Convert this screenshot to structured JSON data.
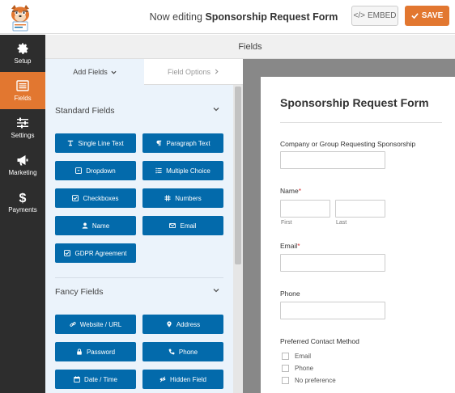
{
  "header": {
    "title_prefix": "Now editing",
    "form_name": "Sponsorship Request Form",
    "embed_label": "EMBED",
    "save_label": "SAVE"
  },
  "sidenav": {
    "items": [
      {
        "label": "Setup",
        "icon": "gear-icon"
      },
      {
        "label": "Fields",
        "icon": "fields-icon",
        "active": true
      },
      {
        "label": "Settings",
        "icon": "sliders-icon"
      },
      {
        "label": "Marketing",
        "icon": "megaphone-icon"
      },
      {
        "label": "Payments",
        "icon": "dollar-icon"
      }
    ]
  },
  "fields_header": "Fields",
  "tabs": {
    "add_fields": "Add Fields",
    "field_options": "Field Options"
  },
  "standard_fields": {
    "title": "Standard Fields",
    "buttons": [
      {
        "label": "Single Line Text",
        "icon": "text-cursor-icon"
      },
      {
        "label": "Paragraph Text",
        "icon": "paragraph-icon"
      },
      {
        "label": "Dropdown",
        "icon": "dropdown-icon"
      },
      {
        "label": "Multiple Choice",
        "icon": "list-icon"
      },
      {
        "label": "Checkboxes",
        "icon": "checkbox-icon"
      },
      {
        "label": "Numbers",
        "icon": "hash-icon"
      },
      {
        "label": "Name",
        "icon": "user-icon"
      },
      {
        "label": "Email",
        "icon": "envelope-icon"
      },
      {
        "label": "GDPR Agreement",
        "icon": "checkbox-icon"
      }
    ]
  },
  "fancy_fields": {
    "title": "Fancy Fields",
    "buttons": [
      {
        "label": "Website / URL",
        "icon": "link-icon"
      },
      {
        "label": "Address",
        "icon": "map-marker-icon"
      },
      {
        "label": "Password",
        "icon": "lock-icon"
      },
      {
        "label": "Phone",
        "icon": "phone-icon"
      },
      {
        "label": "Date / Time",
        "icon": "calendar-icon"
      },
      {
        "label": "Hidden Field",
        "icon": "eye-slash-icon"
      }
    ]
  },
  "form": {
    "title": "Sponsorship Request Form",
    "company_label": "Company or Group Requesting Sponsorship",
    "name_label": "Name",
    "first_sublabel": "First",
    "last_sublabel": "Last",
    "email_label": "Email",
    "phone_label": "Phone",
    "contact_label": "Preferred Contact Method",
    "contact_options": [
      "Email",
      "Phone",
      "No preference"
    ],
    "required_marker": "*"
  },
  "colors": {
    "accent": "#e27730",
    "field_button": "#036aab",
    "sidebar": "#2d2d2d"
  }
}
